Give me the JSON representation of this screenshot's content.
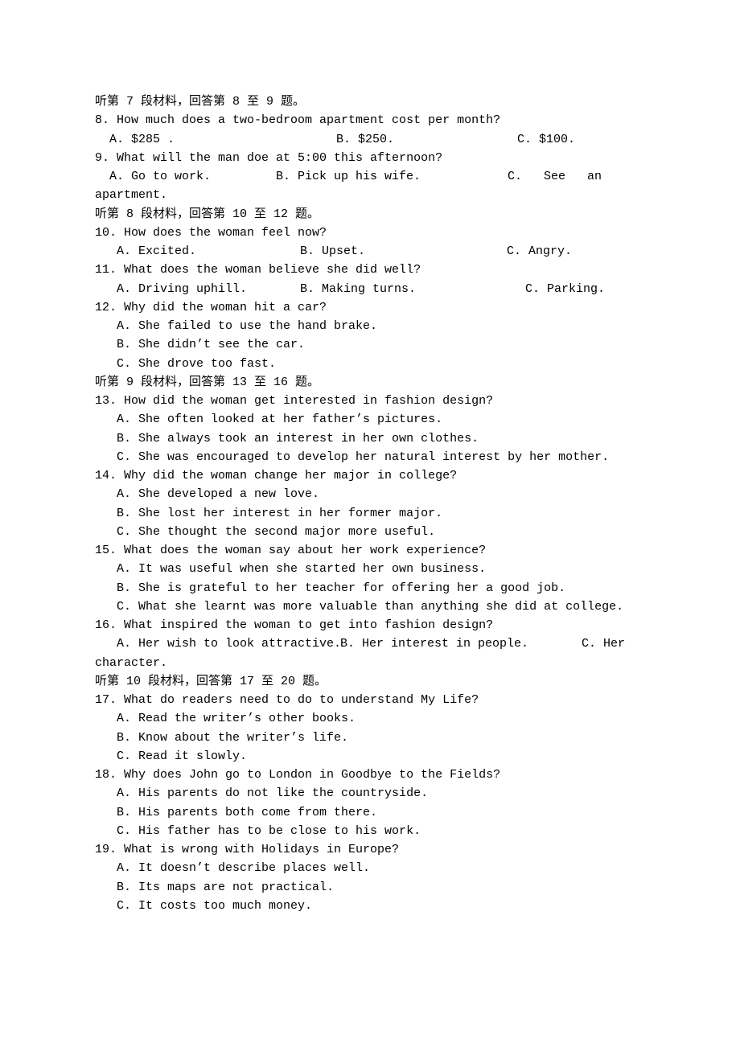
{
  "intro7": "    听第 7 段材料，回答第 8 至 9 题。",
  "q8": {
    "stem": "8. How much does a two-bedroom apartment cost per month?",
    "A": "  A. $285 .",
    "B": "B. $250.",
    "C": "C. $100."
  },
  "q9": {
    "stem": "9. What will the man doe at 5:00 this afternoon?",
    "A": "  A. Go to work.",
    "B": "B. Pick up his wife.",
    "C_pre": "C.   See   an",
    "C_cont": "apartment."
  },
  "intro8": "  听第 8 段材料，回答第 10 至 12 题。",
  "q10": {
    "stem": "10. How does the woman feel now?",
    "A": "   A. Excited.",
    "B": "B. Upset.",
    "C": "C. Angry."
  },
  "q11": {
    "stem": "11. What does the woman believe she did well?",
    "A": "   A. Driving uphill.",
    "B": "B. Making turns.",
    "C": "C. Parking."
  },
  "q12": {
    "stem": "12. Why did the woman hit a car?",
    "A": "   A. She failed to use the hand brake.",
    "B": "   B. She didn’t see the car.",
    "C": "   C. She drove too fast."
  },
  "intro9": "听第 9 段材料，回答第 13 至 16 题。",
  "q13": {
    "stem": "13. How did the woman get interested in fashion design?",
    "A": "   A. She often looked at her father’s pictures.",
    "B": "   B. She always took an interest in her own clothes.",
    "C": "   C. She was encouraged to develop her natural interest by her mother."
  },
  "q14": {
    "stem": "14. Why did the woman change her major in college?",
    "A": "   A. She developed a new love.",
    "B": "   B. She lost her interest in her former major.",
    "C": "   C. She thought the second major more useful."
  },
  "q15": {
    "stem": "15. What does the woman say about her work experience?",
    "A": "   A. It was useful when she started her own business.",
    "B": "   B. She is grateful to her teacher for offering her a good job.",
    "C": "   C. What she learnt was more valuable than anything she did at college."
  },
  "q16": {
    "stem": "16. What inspired the woman to get into fashion design?",
    "A": "   A. Her wish to look attractive.",
    "B": "B. Her interest in people.",
    "C_pre": "C. Her",
    "C_cont": "character."
  },
  "intro10": "听第 10 段材料，回答第 17 至 20 题。",
  "q17": {
    "stem": "17. What do readers need to do to understand My Life?",
    "A": "   A. Read the writer’s other books.",
    "B": "   B. Know about the writer’s life.",
    "C": "   C. Read it slowly."
  },
  "q18": {
    "stem": "18. Why does John go to London in Goodbye to the Fields?",
    "A": "   A. His parents do not like the countryside.",
    "B": "   B. His parents both come from there.",
    "C": "   C. His father has to be close to his work."
  },
  "q19": {
    "stem": "19. What is wrong with Holidays in Europe?",
    "A": "   A. It doesn’t describe places well.",
    "B": "   B. Its maps are not practical.",
    "C": "   C. It costs too much money."
  }
}
